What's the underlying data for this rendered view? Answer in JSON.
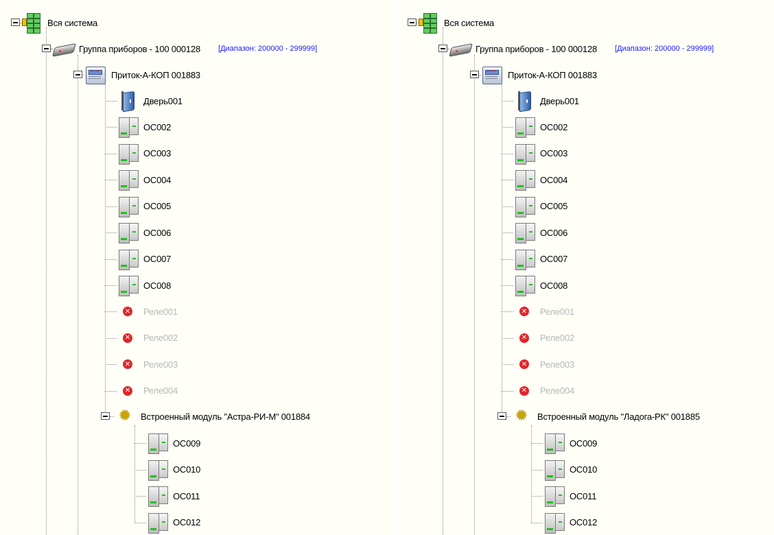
{
  "panes": [
    {
      "root": "Вся система",
      "group": {
        "label": "Группа приборов - 100 000128",
        "range": "[Диапазон: 200000 - 299999]"
      },
      "device": "Приток-А-КОП 001883",
      "door": "Дверь001",
      "zones": [
        "ОС002",
        "ОС003",
        "ОС004",
        "ОС005",
        "ОС006",
        "ОС007",
        "ОС008"
      ],
      "relays": [
        "Реле001",
        "Реле002",
        "Реле003",
        "Реле004"
      ],
      "module": "Встроенный модуль \"Астра-РИ-М\" 001884",
      "module_zones": [
        "ОС009",
        "ОС010",
        "ОС011",
        "ОС012"
      ]
    },
    {
      "root": "Вся система",
      "group": {
        "label": "Группа приборов - 100 000128",
        "range": "[Диапазон: 200000 - 299999]"
      },
      "device": "Приток-А-КОП 001883",
      "door": "Дверь001",
      "zones": [
        "ОС002",
        "ОС003",
        "ОС004",
        "ОС005",
        "ОС006",
        "ОС007",
        "ОС008"
      ],
      "relays": [
        "Реле001",
        "Реле002",
        "Реле003",
        "Реле004"
      ],
      "module": "Встроенный модуль \"Ладога-РК\" 001885",
      "module_zones": [
        "ОС009",
        "ОС010",
        "ОС011",
        "ОС012"
      ]
    }
  ],
  "colors": {
    "range_text": "#1a1aff",
    "disabled_text": "#b6b6b6",
    "relay_error": "#e0262a",
    "zone_ok": "#1fc01f"
  },
  "icons": {
    "root": "system-tree-icon",
    "group": "device-group-icon",
    "device": "panel-device-icon",
    "door": "door-icon",
    "zone": "zone-sensor-icon",
    "relay": "relay-error-icon",
    "module": "module-gear-icon"
  }
}
